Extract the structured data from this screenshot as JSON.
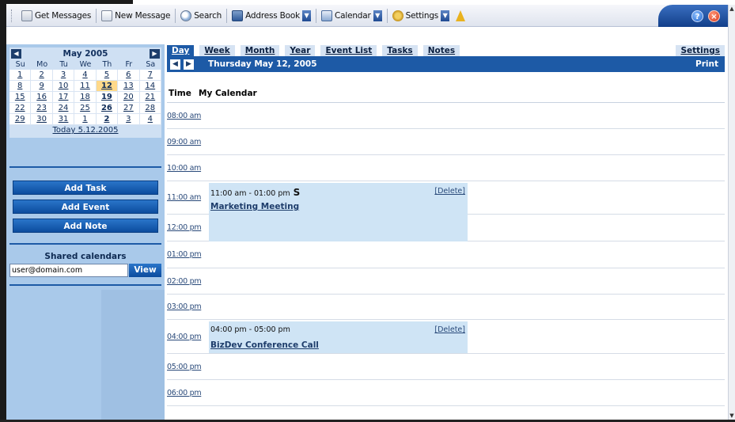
{
  "toolbar": {
    "items": [
      {
        "label": "Get Messages",
        "icon": "mail-icon"
      },
      {
        "label": "New Message",
        "icon": "compose-icon"
      },
      {
        "label": "Search",
        "icon": "search-icon"
      },
      {
        "label": "Address Book",
        "icon": "address-book-icon"
      },
      {
        "label": "Calendar",
        "icon": "calendar-icon"
      },
      {
        "label": "Settings",
        "icon": "settings-icon"
      }
    ],
    "help_glyph": "?",
    "close_glyph": "×"
  },
  "mini_calendar": {
    "month_label": "May 2005",
    "prev_glyph": "◀",
    "next_glyph": "▶",
    "weekdays": [
      "Su",
      "Mo",
      "Tu",
      "We",
      "Th",
      "Fr",
      "Sa"
    ],
    "days": [
      "1",
      "2",
      "3",
      "4",
      "5",
      "6",
      "7",
      "8",
      "9",
      "10",
      "11",
      "12",
      "13",
      "14",
      "15",
      "16",
      "17",
      "18",
      "19",
      "20",
      "21",
      "22",
      "23",
      "24",
      "25",
      "26",
      "27",
      "28",
      "29",
      "30",
      "31",
      "1",
      "2",
      "3",
      "4"
    ],
    "bold_days": [
      11,
      18,
      25,
      32
    ],
    "today_index": 11,
    "today_link": "Today 5.12.2005"
  },
  "sidebar": {
    "add_task": "Add Task",
    "add_event": "Add Event",
    "add_note": "Add Note",
    "shared_title": "Shared calendars",
    "shared_input_value": "user@domain.com",
    "view_button": "View"
  },
  "tabs": {
    "day": "Day",
    "week": "Week",
    "month": "Month",
    "year": "Year",
    "event_list": "Event List",
    "tasks": "Tasks",
    "notes": "Notes",
    "settings": "Settings"
  },
  "daybar": {
    "prev_glyph": "◀",
    "next_glyph": "▶",
    "date_title": "Thursday May 12, 2005",
    "print": "Print"
  },
  "grid": {
    "time_header": "Time",
    "calendar_header": "My Calendar",
    "slots": [
      "08:00 am",
      "09:00 am",
      "10:00 am",
      "11:00 am",
      "12:00 pm",
      "01:00 pm",
      "02:00 pm",
      "03:00 pm",
      "04:00 pm",
      "05:00 pm",
      "06:00 pm"
    ]
  },
  "events": [
    {
      "time_range": "11:00 am - 01:00 pm",
      "recurring_glyph": "S",
      "delete": "[Delete]",
      "title": "Marketing Meeting"
    },
    {
      "time_range": "04:00 pm - 05:00 pm",
      "delete": "[Delete]",
      "title": "BizDev Conference Call"
    }
  ],
  "colors": {
    "sidebar_bg": "#a9c9ea",
    "accent_blue": "#1d5aa6",
    "event_bg": "#cfe4f5",
    "today_highlight": "#ffd98a"
  }
}
